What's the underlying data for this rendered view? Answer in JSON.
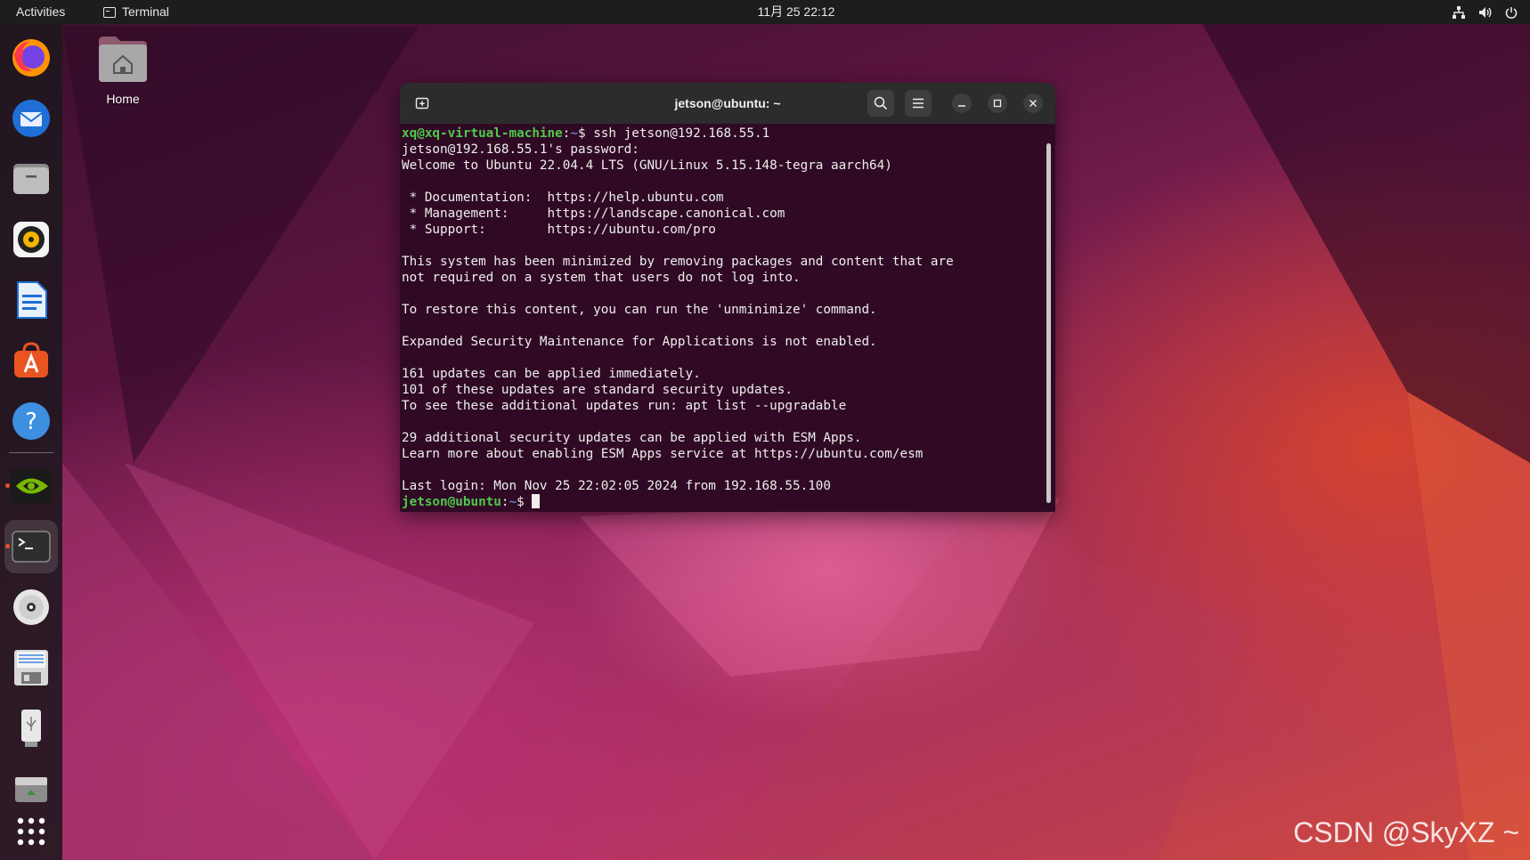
{
  "topbar": {
    "activities": "Activities",
    "app_name": "Terminal",
    "clock": "11月 25  22:12",
    "tray_icons": [
      "network-icon",
      "volume-icon",
      "power-icon"
    ]
  },
  "dock": {
    "items": [
      {
        "name": "firefox-icon"
      },
      {
        "name": "thunderbird-icon"
      },
      {
        "name": "files-icon"
      },
      {
        "name": "rhythmbox-icon"
      },
      {
        "name": "libreoffice-writer-icon"
      },
      {
        "name": "app-center-icon"
      },
      {
        "name": "help-icon"
      },
      {
        "name": "nvidia-settings-icon",
        "running": true
      },
      {
        "name": "terminal-icon",
        "running": true,
        "active": true
      },
      {
        "name": "cd-drive-icon"
      },
      {
        "name": "floppy-drive-icon"
      },
      {
        "name": "usb-drive-icon"
      },
      {
        "name": "trash-icon"
      },
      {
        "name": "show-apps-icon"
      }
    ]
  },
  "desktop": {
    "home_label": "Home"
  },
  "terminal": {
    "title": "jetson@ubuntu: ~",
    "lines": [
      {
        "prompt_user": "xq@xq-virtual-machine",
        "prompt_path": "~",
        "command": "ssh jetson@192.168.55.1"
      },
      {
        "text": "jetson@192.168.55.1's password:"
      },
      {
        "text": "Welcome to Ubuntu 22.04.4 LTS (GNU/Linux 5.15.148-tegra aarch64)"
      },
      {
        "text": ""
      },
      {
        "text": " * Documentation:  https://help.ubuntu.com"
      },
      {
        "text": " * Management:     https://landscape.canonical.com"
      },
      {
        "text": " * Support:        https://ubuntu.com/pro"
      },
      {
        "text": ""
      },
      {
        "text": "This system has been minimized by removing packages and content that are"
      },
      {
        "text": "not required on a system that users do not log into."
      },
      {
        "text": ""
      },
      {
        "text": "To restore this content, you can run the 'unminimize' command."
      },
      {
        "text": ""
      },
      {
        "text": "Expanded Security Maintenance for Applications is not enabled."
      },
      {
        "text": ""
      },
      {
        "text": "161 updates can be applied immediately."
      },
      {
        "text": "101 of these updates are standard security updates."
      },
      {
        "text": "To see these additional updates run: apt list --upgradable"
      },
      {
        "text": ""
      },
      {
        "text": "29 additional security updates can be applied with ESM Apps."
      },
      {
        "text": "Learn more about enabling ESM Apps service at https://ubuntu.com/esm"
      },
      {
        "text": ""
      },
      {
        "text": "Last login: Mon Nov 25 22:02:05 2024 from 192.168.55.100"
      },
      {
        "prompt_user": "jetson@ubuntu",
        "prompt_path": "~",
        "command": "",
        "cursor": true
      }
    ]
  },
  "watermark": "CSDN @SkyXZ ~",
  "colors": {
    "topbar": "#1d1d1d",
    "terminal_bg": "#300a24",
    "prompt_user": "#4ec84e",
    "prompt_path": "#6b7fc4",
    "accent": "#e95420"
  }
}
